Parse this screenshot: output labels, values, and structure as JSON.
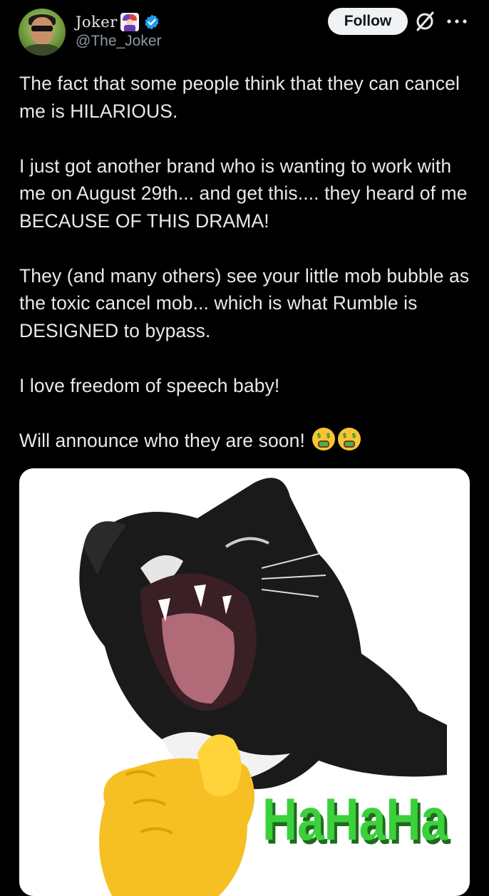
{
  "user": {
    "display_name": "Joker",
    "handle": "@The_Joker",
    "verified": true,
    "accent_color": "#1d9bf0"
  },
  "actions": {
    "follow_label": "Follow"
  },
  "icons": {
    "verified": "verified-badge-icon",
    "grok": "grok-icon",
    "more": "more-options-icon",
    "emoji": "money-mouth-face-emoji"
  },
  "tweet": {
    "paragraphs": [
      "The fact that some people think that they can cancel me is HILARIOUS.",
      "I just got another brand who is wanting to work with me on August 29th... and get this.... they heard of me BECAUSE OF THIS DRAMA!",
      "They (and many others) see your little mob bubble as the toxic cancel mob... which is what Rumble is DESIGNED to bypass.",
      "I love freedom of speech baby!",
      "Will announce who they are soon!"
    ]
  },
  "media": {
    "caption_text": "HaHaHa"
  }
}
